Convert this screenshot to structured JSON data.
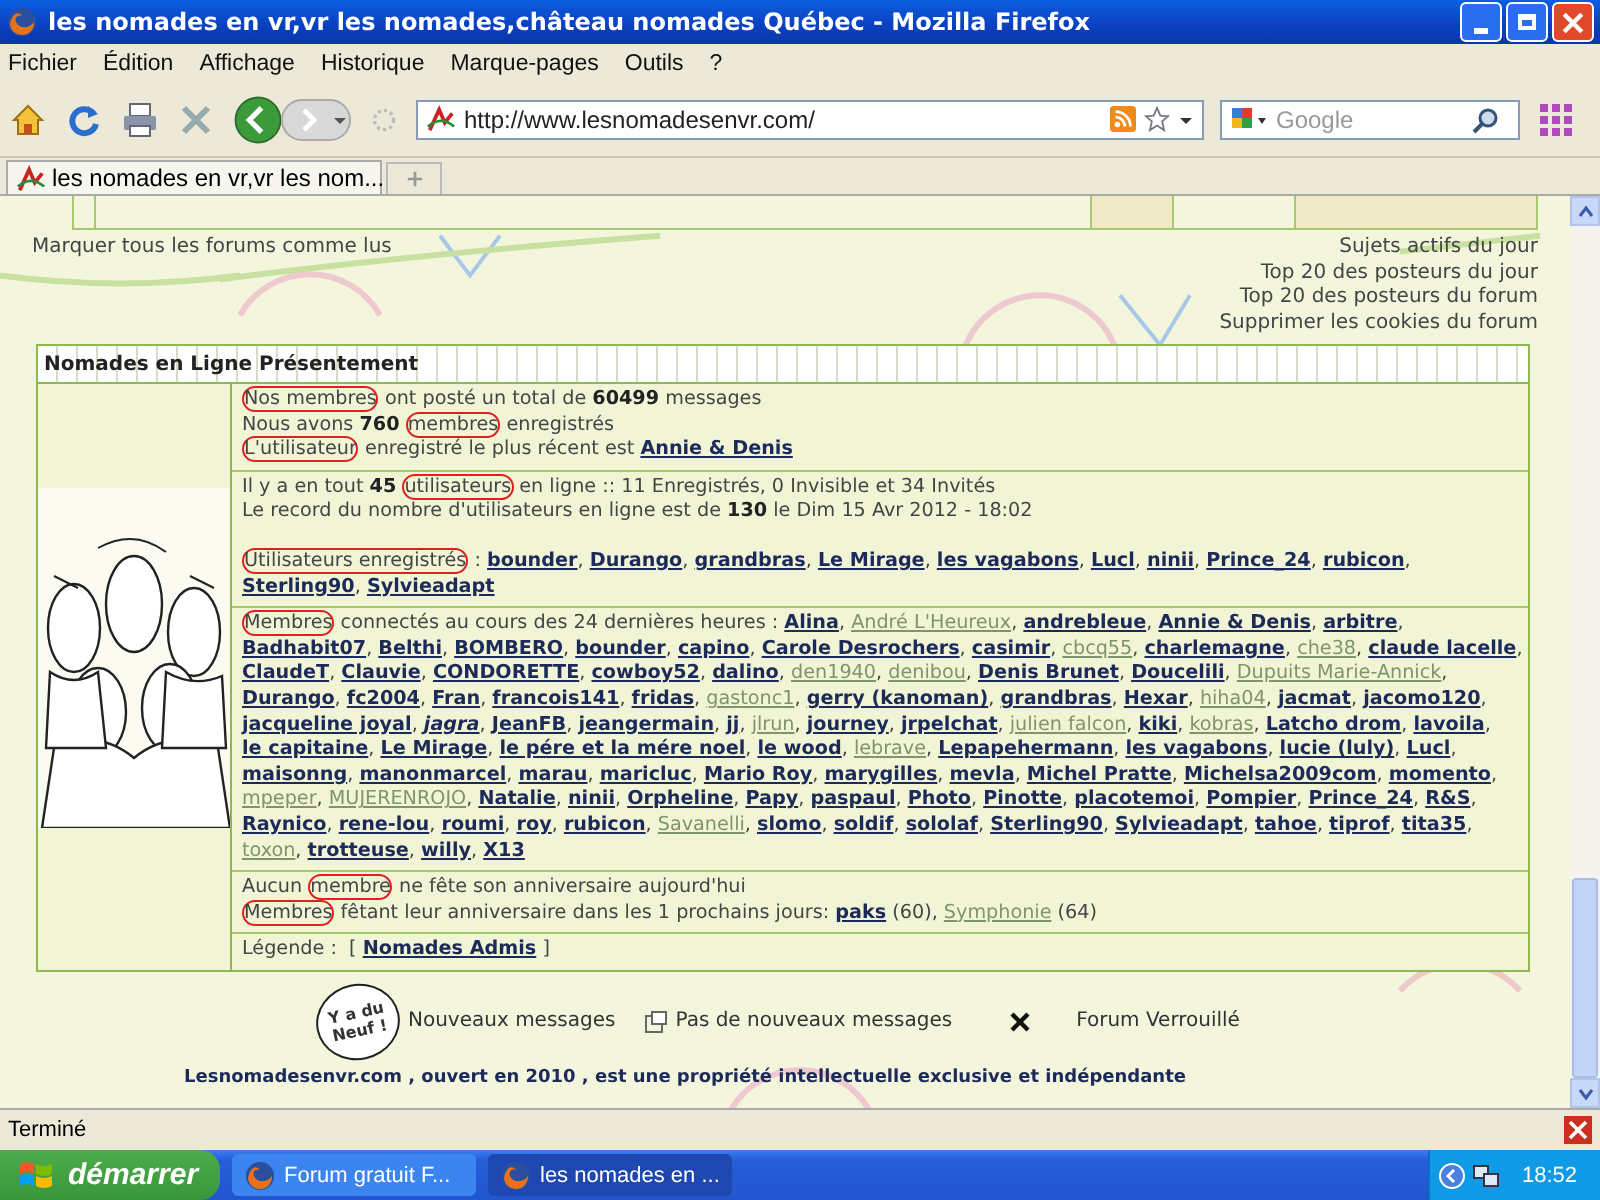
{
  "window": {
    "title": "les nomades en vr,vr les nomades,château nomades Québec - Mozilla Firefox"
  },
  "menu": [
    "Fichier",
    "Édition",
    "Affichage",
    "Historique",
    "Marque-pages",
    "Outils",
    "?"
  ],
  "address": {
    "value": "http://www.lesnomadesenvr.com/"
  },
  "search": {
    "placeholder": "Google"
  },
  "tabs": [
    {
      "label": "les nomades en vr,vr les nom...",
      "selected": true
    }
  ],
  "page": {
    "mark_read": "Marquer tous les forums comme lus",
    "links": [
      "Sujets actifs du jour",
      "Top 20 des posteurs du jour",
      "Top 20 des posteurs du forum",
      "Supprimer les cookies du forum"
    ],
    "panel": {
      "title": "Nomades en Ligne Présentement",
      "sections": [
        {
          "lines": [
            {
              "kind": "info",
              "segments": [
                {
                  "kind": "text",
                  "text": "Nos membres",
                  "circled": true
                },
                {
                  "kind": "text",
                  "text": " ont posté un total de **60499** messages",
                  "circled": false
                }
              ]
            },
            {
              "kind": "info",
              "segments": [
                {
                  "kind": "text",
                  "text": "Nous avons **760** ",
                  "circled": false
                },
                {
                  "kind": "text",
                  "text": "membres",
                  "circled": true
                },
                {
                  "kind": "text",
                  "text": " enregistrés",
                  "circled": false
                }
              ]
            },
            {
              "kind": "info",
              "segments": [
                {
                  "kind": "text",
                  "text": "L'utilisateur",
                  "circled": true
                },
                {
                  "kind": "text",
                  "text": " enregistré le plus récent est ",
                  "circled": false
                },
                {
                  "kind": "link",
                  "text": "Annie & Denis"
                }
              ]
            }
          ]
        },
        {
          "lines": [
            {
              "kind": "info",
              "segments": [
                {
                  "kind": "text",
                  "text": "Il y a en tout **45** ",
                  "circled": false
                },
                {
                  "kind": "text",
                  "text": "utilisateurs",
                  "circled": true
                },
                {
                  "kind": "text",
                  "text": " en ligne :: 11 Enregistrés, 0 Invisible et 34 Invités",
                  "circled": false
                }
              ]
            },
            {
              "kind": "info",
              "segments": [
                {
                  "kind": "text",
                  "text": "Le record du nombre d'utilisateurs en ligne est de **130** le Dim 15 Avr 2012 - 18:02",
                  "circled": false
                }
              ]
            },
            {
              "kind": "list",
              "segments": [
                {
                  "kind": "text",
                  "text": "Utilisateurs enregistrés",
                  "circled": true
                },
                {
                  "kind": "text",
                  "text": " : ",
                  "circled": false
                },
                {
                  "kind": "names",
                  "separator": ", ",
                  "names": [
                    {
                      "name": "bounder",
                      "kind": "member"
                    },
                    {
                      "name": "Durango",
                      "kind": "member"
                    },
                    {
                      "name": "grandbras",
                      "kind": "member"
                    },
                    {
                      "name": "Le Mirage",
                      "kind": "member"
                    },
                    {
                      "name": "les vagabons",
                      "kind": "member"
                    },
                    {
                      "name": "Lucl",
                      "kind": "member"
                    },
                    {
                      "name": "ninii",
                      "kind": "member"
                    },
                    {
                      "name": "Prince_24",
                      "kind": "member"
                    },
                    {
                      "name": "rubicon",
                      "kind": "member"
                    },
                    {
                      "name": "Sterling90",
                      "kind": "member"
                    },
                    {
                      "name": "Sylvieadapt",
                      "kind": "member"
                    }
                  ]
                }
              ]
            }
          ]
        },
        {
          "lines": [
            {
              "kind": "info",
              "segments": [
                {
                  "kind": "text",
                  "text": "Membres",
                  "circled": true
                },
                {
                  "kind": "text",
                  "text": " connectés au cours des 24 dernières heures : ",
                  "circled": false
                },
                {
                  "kind": "names",
                  "separator": ", ",
                  "names": [
                    {
                      "name": "Alina",
                      "kind": "member"
                    },
                    {
                      "name": "André L'Heureux",
                      "kind": "faint"
                    },
                    {
                      "name": "andrebleue",
                      "kind": "member"
                    },
                    {
                      "name": "Annie & Denis",
                      "kind": "member"
                    },
                    {
                      "name": "arbitre",
                      "kind": "member"
                    },
                    {
                      "name": "Badhabit07",
                      "kind": "member"
                    },
                    {
                      "name": "Belthi",
                      "kind": "member"
                    },
                    {
                      "name": "BOMBERO",
                      "kind": "member"
                    },
                    {
                      "name": "bounder",
                      "kind": "member"
                    },
                    {
                      "name": "capino",
                      "kind": "member"
                    },
                    {
                      "name": "Carole Desrochers",
                      "kind": "member"
                    },
                    {
                      "name": "casimir",
                      "kind": "member"
                    },
                    {
                      "name": "cbcq55",
                      "kind": "faint"
                    },
                    {
                      "name": "charlemagne",
                      "kind": "member"
                    },
                    {
                      "name": "che38",
                      "kind": "faint"
                    },
                    {
                      "name": "claude lacelle",
                      "kind": "member"
                    },
                    {
                      "name": "ClaudeT",
                      "kind": "member"
                    },
                    {
                      "name": "Clauvie",
                      "kind": "member"
                    },
                    {
                      "name": "CONDORETTE",
                      "kind": "member"
                    },
                    {
                      "name": "cowboy52",
                      "kind": "member"
                    },
                    {
                      "name": "dalino",
                      "kind": "member"
                    },
                    {
                      "name": "den1940",
                      "kind": "faint"
                    },
                    {
                      "name": "denibou",
                      "kind": "faint"
                    },
                    {
                      "name": "Denis Brunet",
                      "kind": "member"
                    },
                    {
                      "name": "Doucelili",
                      "kind": "member"
                    },
                    {
                      "name": "Dupuits Marie-Annick",
                      "kind": "faint"
                    },
                    {
                      "name": "Durango",
                      "kind": "member"
                    },
                    {
                      "name": "fc2004",
                      "kind": "member"
                    },
                    {
                      "name": "Fran",
                      "kind": "member"
                    },
                    {
                      "name": "francois141",
                      "kind": "member"
                    },
                    {
                      "name": "fridas",
                      "kind": "member"
                    },
                    {
                      "name": "gastonc1",
                      "kind": "faint"
                    },
                    {
                      "name": "gerry (kanoman)",
                      "kind": "member"
                    },
                    {
                      "name": "grandbras",
                      "kind": "member"
                    },
                    {
                      "name": "Hexar",
                      "kind": "member"
                    },
                    {
                      "name": "hiha04",
                      "kind": "faint"
                    },
                    {
                      "name": "jacmat",
                      "kind": "member"
                    },
                    {
                      "name": "jacomo120",
                      "kind": "member"
                    },
                    {
                      "name": "jacqueline joyal",
                      "kind": "member"
                    },
                    {
                      "name": "jagra",
                      "kind": "italic"
                    },
                    {
                      "name": "JeanFB",
                      "kind": "member"
                    },
                    {
                      "name": "jeangermain",
                      "kind": "member"
                    },
                    {
                      "name": "jj",
                      "kind": "member"
                    },
                    {
                      "name": "jlrun",
                      "kind": "faint"
                    },
                    {
                      "name": "journey",
                      "kind": "member"
                    },
                    {
                      "name": "jrpelchat",
                      "kind": "member"
                    },
                    {
                      "name": "julien falcon",
                      "kind": "faint"
                    },
                    {
                      "name": "kiki",
                      "kind": "member"
                    },
                    {
                      "name": "kobras",
                      "kind": "faint"
                    },
                    {
                      "name": "Latcho drom",
                      "kind": "member"
                    },
                    {
                      "name": "lavoila",
                      "kind": "member"
                    },
                    {
                      "name": "le capitaine",
                      "kind": "member"
                    },
                    {
                      "name": "Le Mirage",
                      "kind": "member"
                    },
                    {
                      "name": "le pére et la mére noel",
                      "kind": "member"
                    },
                    {
                      "name": "le wood",
                      "kind": "member"
                    },
                    {
                      "name": "lebrave",
                      "kind": "faint"
                    },
                    {
                      "name": "Lepapehermann",
                      "kind": "member"
                    },
                    {
                      "name": "les vagabons",
                      "kind": "member"
                    },
                    {
                      "name": "lucie (luly)",
                      "kind": "member"
                    },
                    {
                      "name": "Lucl",
                      "kind": "member"
                    },
                    {
                      "name": "maisonng",
                      "kind": "member"
                    },
                    {
                      "name": "manonmarcel",
                      "kind": "member"
                    },
                    {
                      "name": "marau",
                      "kind": "member"
                    },
                    {
                      "name": "maricluc",
                      "kind": "member"
                    },
                    {
                      "name": "Mario Roy",
                      "kind": "member"
                    },
                    {
                      "name": "marygilles",
                      "kind": "member"
                    },
                    {
                      "name": "mevla",
                      "kind": "member"
                    },
                    {
                      "name": "Michel Pratte",
                      "kind": "member"
                    },
                    {
                      "name": "Michelsa2009com",
                      "kind": "member"
                    },
                    {
                      "name": "momento",
                      "kind": "member"
                    },
                    {
                      "name": "mpeper",
                      "kind": "faint"
                    },
                    {
                      "name": "MUJERENROJO",
                      "kind": "faint"
                    },
                    {
                      "name": "Natalie",
                      "kind": "member"
                    },
                    {
                      "name": "ninii",
                      "kind": "member"
                    },
                    {
                      "name": "Orpheline",
                      "kind": "member"
                    },
                    {
                      "name": "Papy",
                      "kind": "member"
                    },
                    {
                      "name": "paspaul",
                      "kind": "member"
                    },
                    {
                      "name": "Photo",
                      "kind": "member"
                    },
                    {
                      "name": "Pinotte",
                      "kind": "member"
                    },
                    {
                      "name": "placotemoi",
                      "kind": "member"
                    },
                    {
                      "name": "Pompier",
                      "kind": "member"
                    },
                    {
                      "name": "Prince_24",
                      "kind": "member"
                    },
                    {
                      "name": "R&S",
                      "kind": "member"
                    },
                    {
                      "name": "Raynico",
                      "kind": "member"
                    },
                    {
                      "name": "rene-lou",
                      "kind": "member"
                    },
                    {
                      "name": "roumi",
                      "kind": "member"
                    },
                    {
                      "name": "roy",
                      "kind": "member"
                    },
                    {
                      "name": "rubicon",
                      "kind": "member"
                    },
                    {
                      "name": "Savanelli",
                      "kind": "faint"
                    },
                    {
                      "name": "slomo",
                      "kind": "member"
                    },
                    {
                      "name": "soldif",
                      "kind": "member"
                    },
                    {
                      "name": "sololaf",
                      "kind": "member"
                    },
                    {
                      "name": "Sterling90",
                      "kind": "member"
                    },
                    {
                      "name": "Sylvieadapt",
                      "kind": "member"
                    },
                    {
                      "name": "tahoe",
                      "kind": "member"
                    },
                    {
                      "name": "tiprof",
                      "kind": "member"
                    },
                    {
                      "name": "tita35",
                      "kind": "member"
                    },
                    {
                      "name": "toxon",
                      "kind": "faint"
                    },
                    {
                      "name": "trotteuse",
                      "kind": "member"
                    },
                    {
                      "name": "willy",
                      "kind": "member"
                    },
                    {
                      "name": "X13",
                      "kind": "member"
                    }
                  ]
                }
              ]
            }
          ]
        },
        {
          "lines": [
            {
              "kind": "info",
              "segments": [
                {
                  "kind": "text",
                  "text": "Aucun ",
                  "circled": false
                },
                {
                  "kind": "text",
                  "text": "membre",
                  "circled": true
                },
                {
                  "kind": "text",
                  "text": " ne fête son anniversaire aujourd'hui",
                  "circled": false
                }
              ]
            },
            {
              "kind": "info",
              "segments": [
                {
                  "kind": "text",
                  "text": "Membres",
                  "circled": true
                },
                {
                  "kind": "text",
                  "text": " fêtant leur anniversaire dans les 1 prochains jours: ",
                  "circled": false
                },
                {
                  "kind": "link",
                  "text": "paks"
                },
                {
                  "kind": "text",
                  "text": " (60), ",
                  "circled": false
                },
                {
                  "kind": "faint_link",
                  "text": "Symphonie"
                },
                {
                  "kind": "text",
                  "text": " (64)",
                  "circled": false
                }
              ]
            }
          ]
        },
        {
          "lines": [
            {
              "kind": "info",
              "segments": [
                {
                  "kind": "text",
                  "text": "Légende :  [ ",
                  "circled": false
                },
                {
                  "kind": "link",
                  "text": "Nomades Admis"
                },
                {
                  "kind": "text",
                  "text": " ]",
                  "circled": false
                }
              ]
            }
          ]
        }
      ]
    },
    "legend": [
      {
        "kind": "new",
        "badge": "Y a du Neuf !",
        "label": "Nouveaux messages"
      },
      {
        "kind": "none",
        "label": "Pas de nouveaux messages"
      },
      {
        "kind": "locked",
        "label": "Forum Verrouillé"
      }
    ],
    "footer": "Lesnomadesenvr.com , ouvert en 2010 , est une propriété intellectuelle exclusive et indépendante"
  },
  "status_bar": "Terminé",
  "taskbar": {
    "start": "démarrer",
    "tasks": [
      {
        "label": "Forum gratuit F...",
        "selected": false
      },
      {
        "label": "les nomades en ...",
        "selected": true
      }
    ],
    "clock": "18:52"
  }
}
